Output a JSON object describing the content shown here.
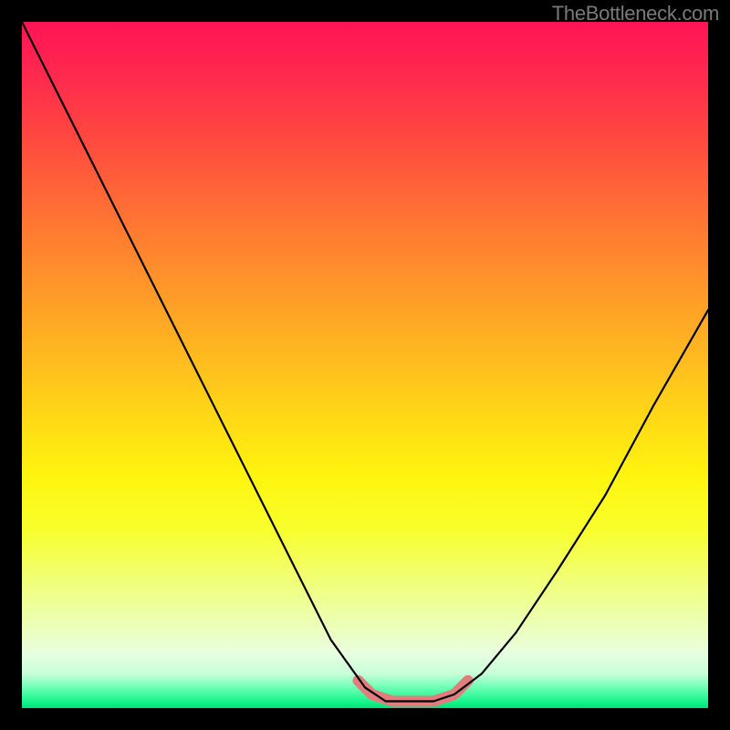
{
  "watermark": "TheBottleneck.com",
  "chart_data": {
    "type": "line",
    "title": "",
    "xlabel": "",
    "ylabel": "",
    "xlim": [
      0,
      1
    ],
    "ylim": [
      0,
      1
    ],
    "series": [
      {
        "name": "bottleneck-curve",
        "x": [
          0.0,
          0.05,
          0.1,
          0.15,
          0.2,
          0.25,
          0.3,
          0.35,
          0.4,
          0.45,
          0.5,
          0.53,
          0.56,
          0.6,
          0.63,
          0.67,
          0.72,
          0.78,
          0.85,
          0.92,
          1.0
        ],
        "y": [
          1.0,
          0.9,
          0.8,
          0.7,
          0.6,
          0.5,
          0.4,
          0.3,
          0.2,
          0.1,
          0.03,
          0.01,
          0.01,
          0.01,
          0.02,
          0.05,
          0.11,
          0.2,
          0.31,
          0.44,
          0.58
        ]
      },
      {
        "name": "salmon-base-highlight",
        "x": [
          0.49,
          0.51,
          0.54,
          0.57,
          0.6,
          0.63,
          0.65
        ],
        "y": [
          0.04,
          0.02,
          0.01,
          0.01,
          0.01,
          0.02,
          0.04
        ]
      }
    ]
  }
}
